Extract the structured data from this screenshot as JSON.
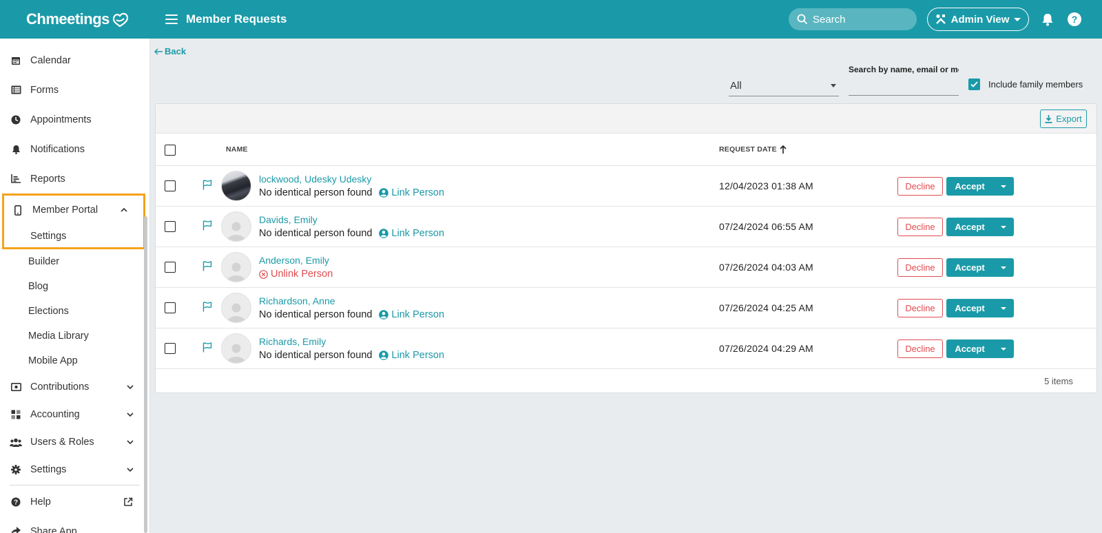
{
  "app": {
    "logo": "Chmeetings",
    "page_title": "Member Requests",
    "search_placeholder": "Search",
    "admin_view": "Admin View",
    "help": "?"
  },
  "colors": {
    "brand": "#1a9aa8",
    "danger": "#e04b4f",
    "highlight": "#f5a21b"
  },
  "sidebar": {
    "items_top": [
      {
        "label": "Calendar",
        "icon": "calendar-icon"
      },
      {
        "label": "Forms",
        "icon": "forms-icon"
      },
      {
        "label": "Appointments",
        "icon": "clock-icon"
      },
      {
        "label": "Notifications",
        "icon": "bell-icon"
      },
      {
        "label": "Reports",
        "icon": "chart-icon"
      }
    ],
    "member_portal": {
      "label": "Member Portal",
      "icon": "phone-icon",
      "expanded": true,
      "highlighted_child": "Settings",
      "children": [
        "Settings",
        "Builder",
        "Blog",
        "Elections",
        "Media Library",
        "Mobile App"
      ]
    },
    "items_collapsible": [
      {
        "label": "Contributions",
        "icon": "money-icon"
      },
      {
        "label": "Accounting",
        "icon": "grid-icon"
      },
      {
        "label": "Users & Roles",
        "icon": "users-icon"
      },
      {
        "label": "Settings",
        "icon": "gear-icon"
      }
    ],
    "items_bottom": [
      {
        "label": "Help",
        "icon": "question-icon"
      },
      {
        "label": "Share App",
        "icon": "share-icon"
      }
    ]
  },
  "main": {
    "back": "Back",
    "filter_value": "All",
    "search_label": "Search by name, email or mol",
    "search_value": "",
    "include_family_label": "Include family members",
    "include_family_checked": true,
    "export": "Export",
    "columns": {
      "name": "NAME",
      "request_date": "REQUEST DATE"
    },
    "rows": [
      {
        "name": "lockwood, Udesky Udesky",
        "status": "No identical person found",
        "action": "Link Person",
        "action_type": "link",
        "date": "12/04/2023 01:38 AM",
        "avatar": "photo"
      },
      {
        "name": "Davids, Emily",
        "status": "No identical person found",
        "action": "Link Person",
        "action_type": "link",
        "date": "07/24/2024 06:55 AM",
        "avatar": "placeholder"
      },
      {
        "name": "Anderson, Emily",
        "status": "",
        "action": "Unlink Person",
        "action_type": "unlink",
        "date": "07/26/2024 04:03 AM",
        "avatar": "placeholder"
      },
      {
        "name": "Richardson, Anne",
        "status": "No identical person found",
        "action": "Link Person",
        "action_type": "link",
        "date": "07/26/2024 04:25 AM",
        "avatar": "placeholder"
      },
      {
        "name": "Richards, Emily",
        "status": "No identical person found",
        "action": "Link Person",
        "action_type": "link",
        "date": "07/26/2024 04:29 AM",
        "avatar": "placeholder"
      }
    ],
    "decline_label": "Decline",
    "accept_label": "Accept",
    "footer": "5 items"
  }
}
